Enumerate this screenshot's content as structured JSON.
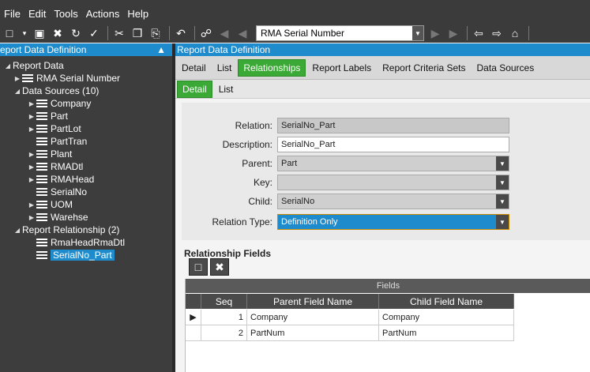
{
  "menu": [
    "File",
    "Edit",
    "Tools",
    "Actions",
    "Help"
  ],
  "toolbar": {
    "combo_value": "RMA Serial Number"
  },
  "left_panel": {
    "title": "eport Data Definition",
    "pin": "↗",
    "tree": [
      {
        "label": "Report Data",
        "level": 0,
        "exp": "◢",
        "icon": false
      },
      {
        "label": "RMA Serial Number",
        "level": 1,
        "exp": "▶",
        "icon": true
      },
      {
        "label": "Data Sources (10)",
        "level": 1,
        "exp": "◢",
        "icon": false
      },
      {
        "label": "Company",
        "level": 2,
        "exp": "▶",
        "icon": true
      },
      {
        "label": "Part",
        "level": 2,
        "exp": "▶",
        "icon": true
      },
      {
        "label": "PartLot",
        "level": 2,
        "exp": "▶",
        "icon": true
      },
      {
        "label": "PartTran",
        "level": 2,
        "exp": "",
        "icon": true
      },
      {
        "label": "Plant",
        "level": 2,
        "exp": "▶",
        "icon": true
      },
      {
        "label": "RMADtl",
        "level": 2,
        "exp": "▶",
        "icon": true
      },
      {
        "label": "RMAHead",
        "level": 2,
        "exp": "▶",
        "icon": true
      },
      {
        "label": "SerialNo",
        "level": 2,
        "exp": "",
        "icon": true
      },
      {
        "label": "UOM",
        "level": 2,
        "exp": "▶",
        "icon": true
      },
      {
        "label": "Warehse",
        "level": 2,
        "exp": "▶",
        "icon": true
      },
      {
        "label": "Report Relationship (2)",
        "level": 1,
        "exp": "◢",
        "icon": false
      },
      {
        "label": "RmaHeadRmaDtl",
        "level": 2,
        "exp": "",
        "icon": true
      },
      {
        "label": "SerialNo_Part",
        "level": 2,
        "exp": "",
        "icon": true,
        "selected": true
      }
    ]
  },
  "content": {
    "title": "Report Data Definition",
    "tabs": [
      "Detail",
      "List",
      "Relationships",
      "Report Labels",
      "Report Criteria Sets",
      "Data Sources"
    ],
    "active_tab": "Relationships",
    "subtabs": [
      "Detail",
      "List"
    ],
    "active_subtab": "Detail",
    "form": {
      "relation_label": "Relation:",
      "relation_value": "SerialNo_Part",
      "description_label": "Description:",
      "description_value": "SerialNo_Part",
      "parent_label": "Parent:",
      "parent_value": "Part",
      "key_label": "Key:",
      "key_value": "",
      "child_label": "Child:",
      "child_value": "SerialNo",
      "relation_type_label": "Relation Type:",
      "relation_type_value": "Definition Only"
    },
    "fields_section": {
      "title": "Relationship Fields",
      "group_header": "Fields",
      "columns": [
        "Seq",
        "Parent Field Name",
        "Child Field Name"
      ],
      "rows": [
        {
          "seq": "1",
          "parent": "Company",
          "child": "Company",
          "current": true
        },
        {
          "seq": "2",
          "parent": "PartNum",
          "child": "PartNum",
          "current": false
        }
      ]
    }
  },
  "colors": {
    "accent_blue": "#1e8bcd",
    "tab_green": "#3aa935",
    "dark_panel": "#3d3d3d"
  }
}
